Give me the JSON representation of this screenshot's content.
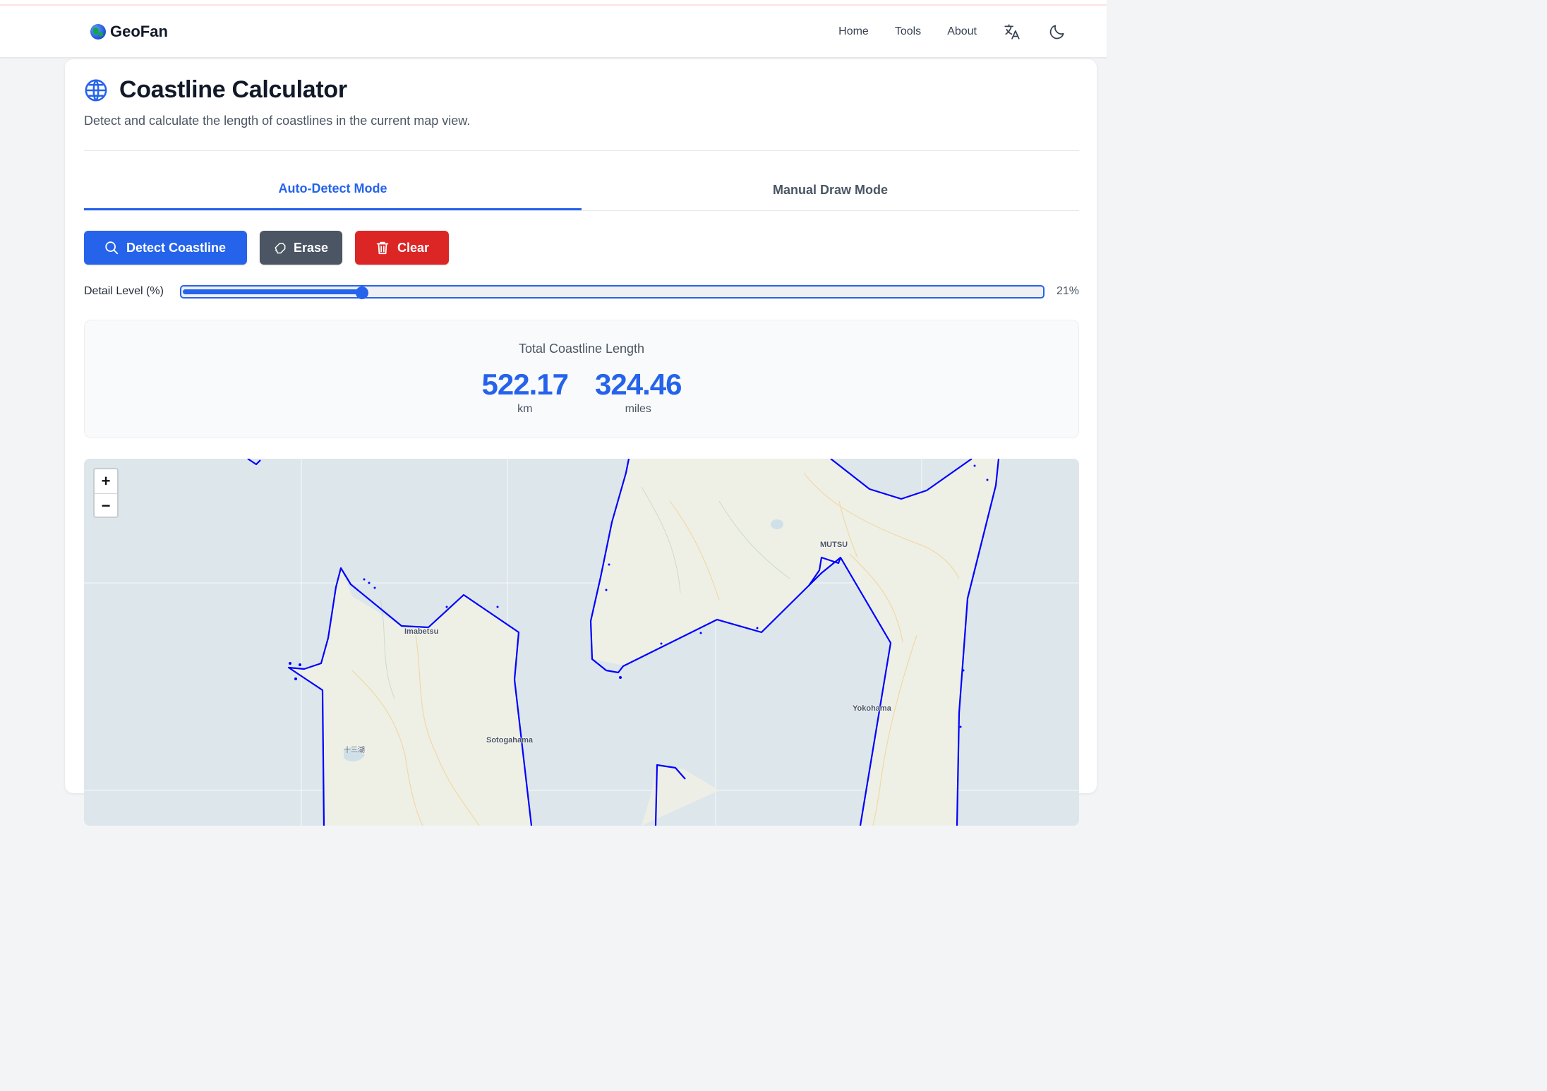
{
  "brand": {
    "name": "GeoFan",
    "logo_icon": "globe-emoji-icon"
  },
  "nav": {
    "links": [
      "Home",
      "Tools",
      "About"
    ],
    "icons": [
      "translate-icon",
      "moon-icon"
    ]
  },
  "page": {
    "title": "Coastline Calculator",
    "subtitle": "Detect and calculate the length of coastlines in the current map view."
  },
  "tabs": [
    {
      "label": "Auto-Detect Mode",
      "active": true
    },
    {
      "label": "Manual Draw Mode",
      "active": false
    }
  ],
  "buttons": {
    "detect": "Detect Coastline",
    "erase": "Erase",
    "clear": "Clear"
  },
  "slider": {
    "label": "Detail Level (%)",
    "value": 21,
    "value_text": "21%"
  },
  "result": {
    "title": "Total Coastline Length",
    "km_value": "522.17",
    "km_unit": "km",
    "miles_value": "324.46",
    "miles_unit": "miles"
  },
  "map": {
    "zoom_in": "+",
    "zoom_out": "−",
    "labels": [
      "Imabetsu",
      "MUTSU",
      "Sotogahama",
      "Yokohama",
      "十三湖"
    ],
    "coastline_color": "#0000ff",
    "water_color": "#dde6eb",
    "land_color": "#eef0e6"
  },
  "colors": {
    "accent": "#2563eb",
    "danger": "#dc2626",
    "secondary": "#4b5563"
  }
}
